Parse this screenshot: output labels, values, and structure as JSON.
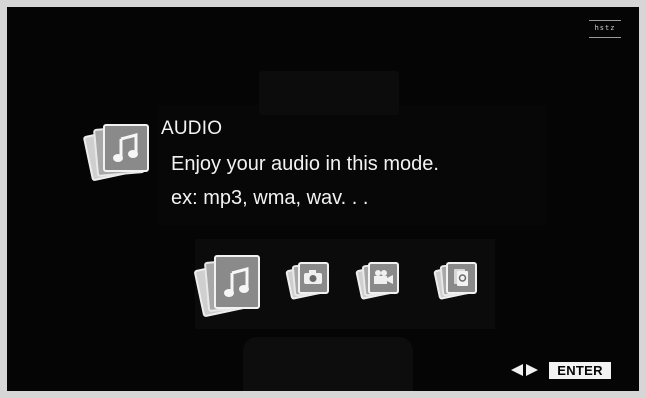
{
  "device_logo": "hstz",
  "mode": {
    "title": "AUDIO",
    "description": "Enjoy your audio in this mode.",
    "formats": "ex: mp3, wma, wav. . ."
  },
  "mode_selector": {
    "items": [
      {
        "icon": "music-note-icon",
        "selected": true
      },
      {
        "icon": "camera-icon",
        "selected": false
      },
      {
        "icon": "video-camera-icon",
        "selected": false
      },
      {
        "icon": "file-icon",
        "selected": false
      }
    ]
  },
  "footer": {
    "nav_icons": "left-right-arrows-icon",
    "enter_label": "ENTER"
  }
}
